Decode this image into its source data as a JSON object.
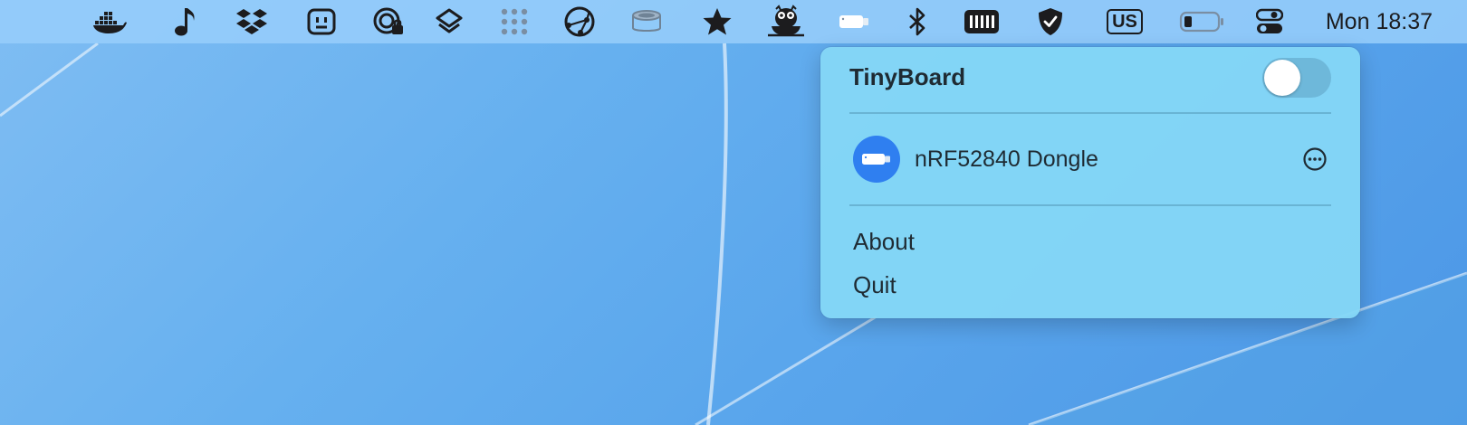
{
  "menubar": {
    "icons": [
      "docker-icon",
      "music-note-icon",
      "dropbox-icon",
      "app-face-icon",
      "password-lock-icon",
      "shortcuts-icon",
      "dot-grid-icon",
      "network-globe-icon",
      "disk-icon",
      "star-icon",
      "owl-coffee-icon",
      "usb-dongle-icon",
      "bluetooth-icon",
      "memory-icon",
      "shield-check-icon",
      "battery-icon",
      "control-center-icon"
    ],
    "input_source": "US",
    "clock": "Mon 18:37"
  },
  "popover": {
    "title": "TinyBoard",
    "toggle_on": false,
    "device": {
      "name": "nRF52840 Dongle",
      "icon": "usb-dongle-icon"
    },
    "menu": {
      "about": "About",
      "quit": "Quit"
    }
  },
  "colors": {
    "device_avatar": "#2f7ff0",
    "popover_bg": "#84d6f6",
    "menubar_bg": "#96cdfa"
  }
}
